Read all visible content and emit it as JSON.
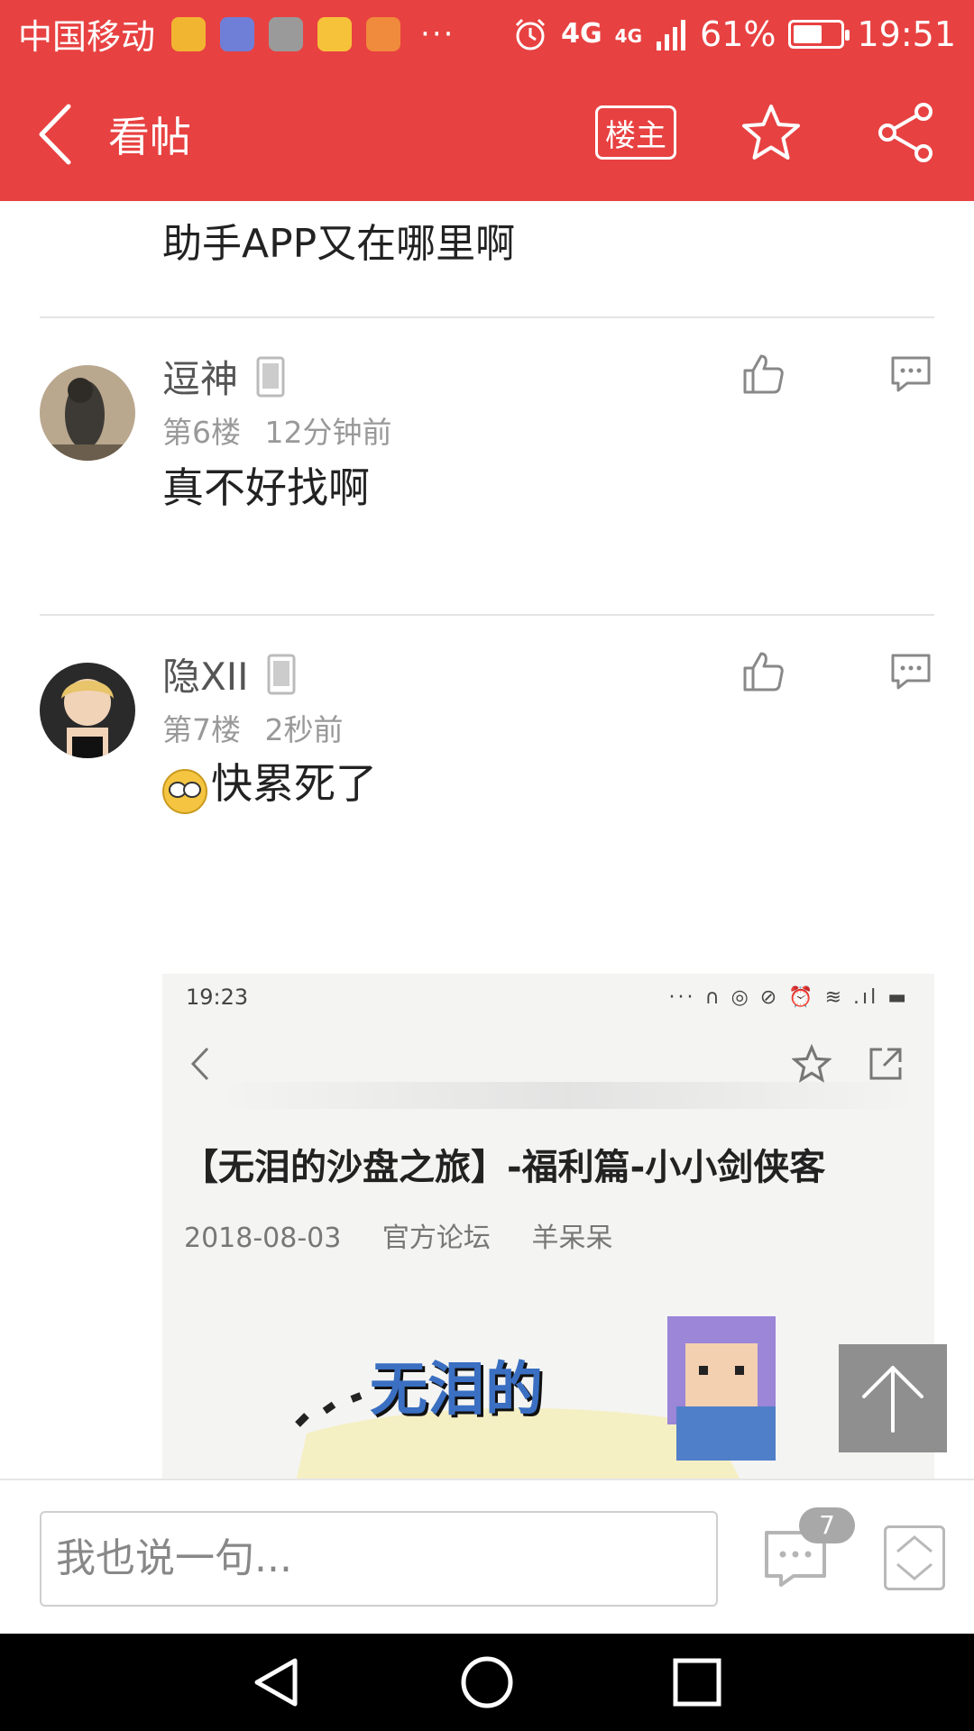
{
  "status_bar": {
    "carrier": "中国移动",
    "more": "···",
    "network_1": "4G",
    "network_2": "4G",
    "battery_text": "61%",
    "battery_level": 0.61,
    "time": "19:51"
  },
  "header": {
    "title": "看帖",
    "owner_label": "楼主",
    "colors": {
      "accent": "#e84141"
    }
  },
  "previous_post": {
    "text_tail": "助手APP又在哪里啊"
  },
  "posts": [
    {
      "username": "逗神",
      "floor": "第6楼",
      "time": "12分钟前",
      "text": "真不好找啊"
    },
    {
      "username": "隐XII",
      "floor": "第7楼",
      "time": "2秒前",
      "text": "快累死了",
      "image": {
        "status_time": "19:23",
        "status_icons": "··· ∩ ◎ ⊘ ⏰ ≋ .ıl ▬",
        "title": "【无泪的沙盘之旅】-福利篇-小小剑侠客",
        "date": "2018-08-03",
        "source": "官方论坛",
        "author": "羊呆呆",
        "banner_text": "无泪的"
      }
    }
  ],
  "bottom_bar": {
    "input_placeholder": "我也说一句...",
    "comment_count": "7"
  }
}
